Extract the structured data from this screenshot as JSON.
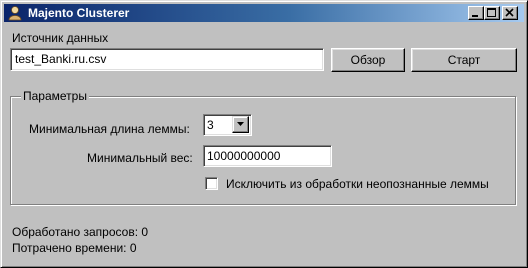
{
  "window": {
    "title": "Majento Clusterer",
    "icon": "app-icon",
    "controls": {
      "minimize_icon": "minimize-icon",
      "maximize_icon": "maximize-icon",
      "close_icon": "close-icon"
    }
  },
  "source": {
    "label": "Источник данных",
    "value": "test_Banki.ru.csv",
    "browse_label": "Обзор",
    "start_label": "Старт"
  },
  "params": {
    "legend": "Параметры",
    "min_lemma_length_label": "Минимальная длина леммы:",
    "min_lemma_length_value": "3",
    "min_weight_label": "Минимальный вес:",
    "min_weight_value": "10000000000",
    "exclude_unknown_label": "Исключить из обработки неопознанные леммы",
    "exclude_unknown_checked": false
  },
  "status": {
    "processed_label": "Обработано запросов: 0",
    "time_label": "Потрачено времени: 0"
  },
  "colors": {
    "face": "#c0c0c0",
    "title_start": "#0a246a",
    "title_end": "#a6caf0"
  }
}
